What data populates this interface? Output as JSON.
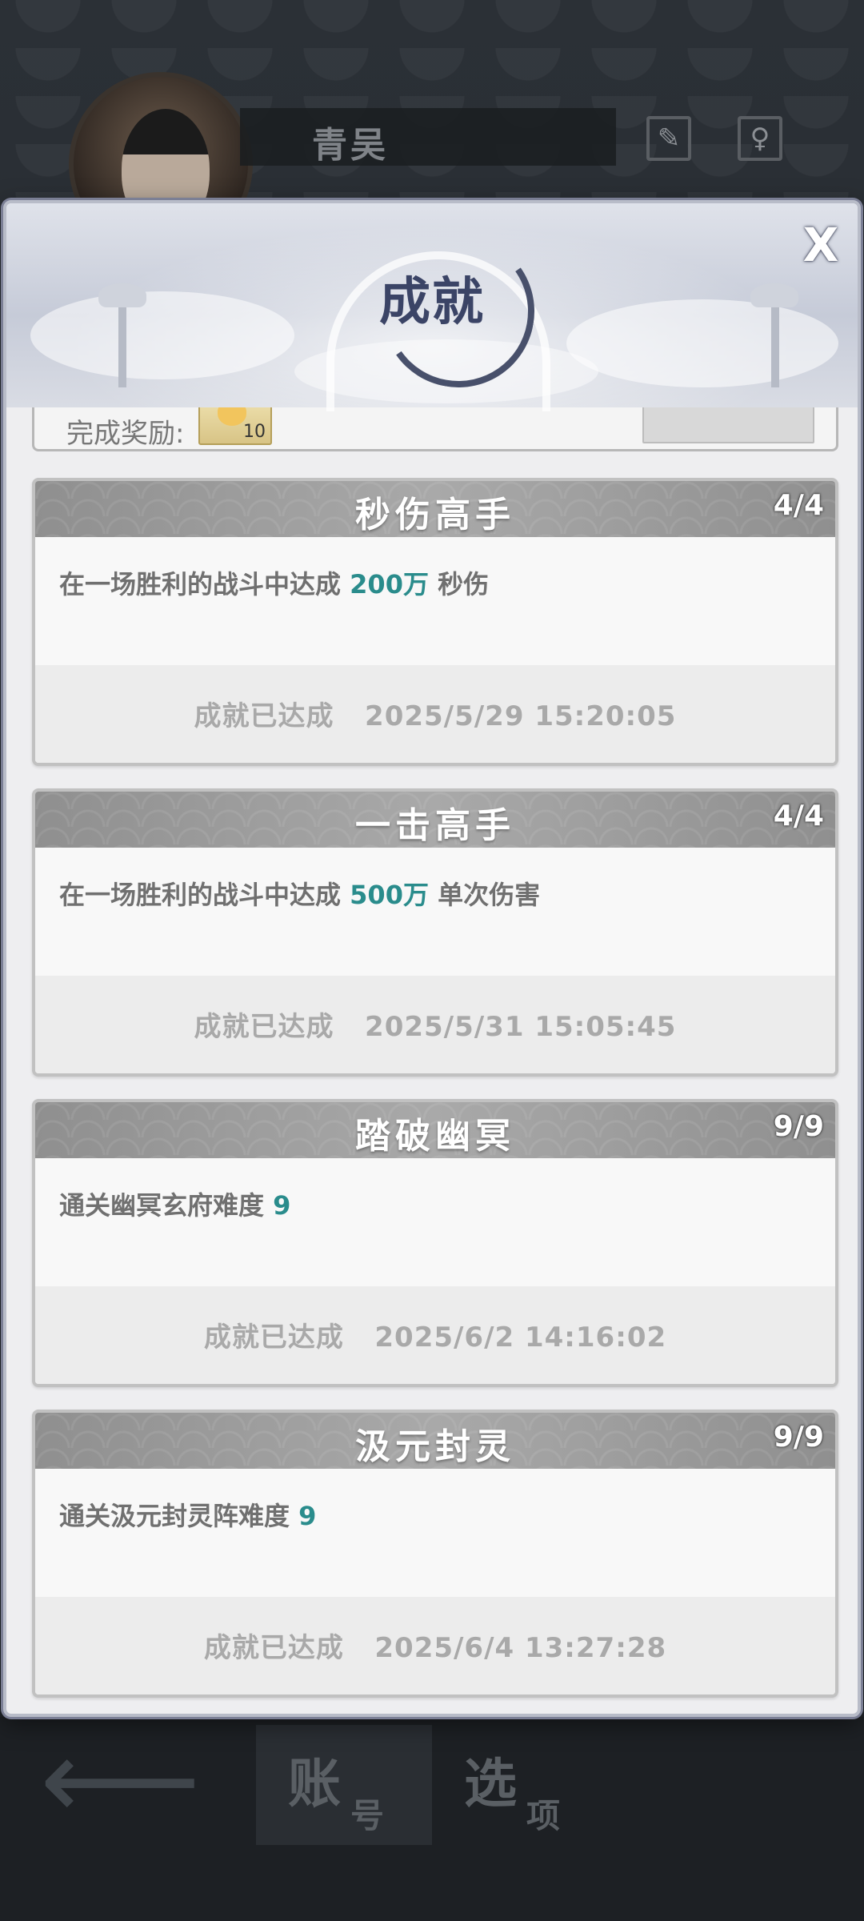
{
  "background": {
    "player_name": "青吴",
    "icons": [
      "brush-icon",
      "gender-icon"
    ],
    "footer": {
      "tabs": [
        {
          "big": "账",
          "small": "号"
        },
        {
          "big": "选",
          "small": "项"
        }
      ]
    }
  },
  "modal": {
    "title": "成就",
    "close_label": "X",
    "partial": {
      "reward_label": "完成奖励:",
      "reward_count": "10"
    },
    "achievements": [
      {
        "name": "秒伤高手",
        "progress": "4/4",
        "desc_prefix": "在一场胜利的战斗中达成 ",
        "desc_value": "200万",
        "desc_suffix": " 秒伤",
        "status": "成就已达成",
        "time": "2025/5/29 15:20:05"
      },
      {
        "name": "一击高手",
        "progress": "4/4",
        "desc_prefix": "在一场胜利的战斗中达成 ",
        "desc_value": "500万",
        "desc_suffix": " 单次伤害",
        "status": "成就已达成",
        "time": "2025/5/31 15:05:45"
      },
      {
        "name": "踏破幽冥",
        "progress": "9/9",
        "desc_prefix": "通关幽冥玄府难度 ",
        "desc_value": "9",
        "desc_suffix": "",
        "status": "成就已达成",
        "time": "2025/6/2 14:16:02"
      },
      {
        "name": "汲元封灵",
        "progress": "9/9",
        "desc_prefix": "通关汲元封灵阵难度 ",
        "desc_value": "9",
        "desc_suffix": "",
        "status": "成就已达成",
        "time": "2025/6/4 13:27:28"
      }
    ]
  }
}
